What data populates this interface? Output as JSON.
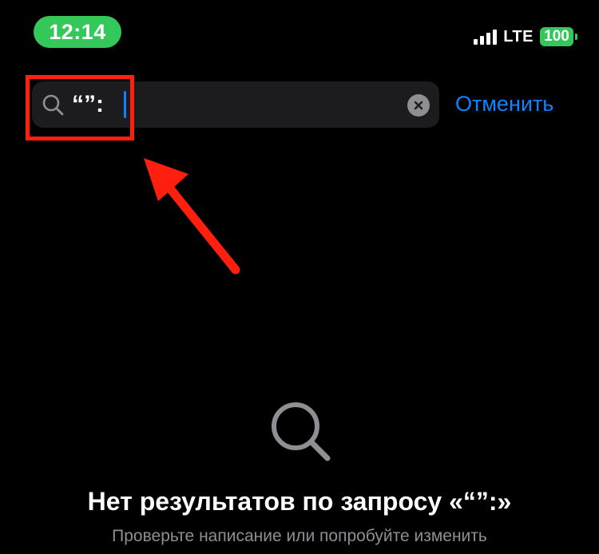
{
  "status_bar": {
    "time": "12:14",
    "network": "LTE",
    "battery": "100",
    "time_pill_color": "#34c759",
    "battery_color": "#34c759"
  },
  "search": {
    "query": "“”:",
    "clear_icon": "xmark-circle-icon",
    "search_icon": "magnifying-glass-icon"
  },
  "cancel_label": "Отменить",
  "empty_state": {
    "icon": "magnifying-glass-icon",
    "title": "Нет результатов по запросу «“”:»",
    "subtitle": "Проверьте написание или попробуйте изменить"
  },
  "colors": {
    "background": "#000000",
    "accent": "#0a84ff",
    "annotation": "#ff1f0f",
    "secondary_text": "#8e8e93"
  }
}
